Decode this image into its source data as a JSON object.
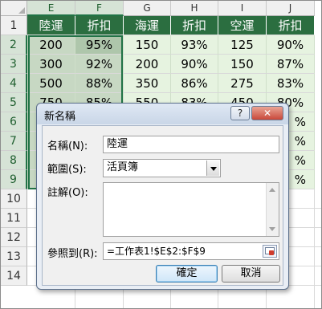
{
  "spreadsheet": {
    "columns": [
      "E",
      "F",
      "G",
      "H",
      "I",
      "J"
    ],
    "rows": [
      "1",
      "2",
      "3",
      "4",
      "5",
      "6",
      "7",
      "8",
      "9",
      "10",
      "11",
      "12",
      "13",
      "14"
    ],
    "header": [
      "陸運",
      "折扣",
      "海運",
      "折扣",
      "空運",
      "折扣"
    ],
    "data": [
      [
        "200",
        "95%",
        "150",
        "93%",
        "125",
        "90%"
      ],
      [
        "300",
        "92%",
        "200",
        "90%",
        "150",
        "87%"
      ],
      [
        "500",
        "88%",
        "350",
        "86%",
        "275",
        "83%"
      ],
      [
        "750",
        "85%",
        "550",
        "83%",
        "450",
        "80%"
      ],
      [
        "",
        "",
        "",
        "",
        "",
        "%"
      ],
      [
        "",
        "",
        "",
        "",
        "",
        "%"
      ],
      [
        "",
        "",
        "",
        "",
        "",
        "%"
      ],
      [
        "",
        "",
        "",
        "",
        "",
        "%"
      ]
    ]
  },
  "dialog": {
    "title": "新名稱",
    "help_button": "?",
    "close_button": "✕",
    "name_label": "名稱(N):",
    "name_value": "陸運",
    "scope_label": "範圍(S):",
    "scope_value": "活頁簿",
    "comment_label": "註解(O):",
    "comment_value": "",
    "refers_label": "參照到(R):",
    "refers_value": "=工作表1!$E$2:$F$9",
    "ok_button": "確定",
    "cancel_button": "取消"
  },
  "colors": {
    "header_fill": "#2b6e40",
    "body_fill": "#e6f3e0",
    "selection_border": "#217346"
  }
}
